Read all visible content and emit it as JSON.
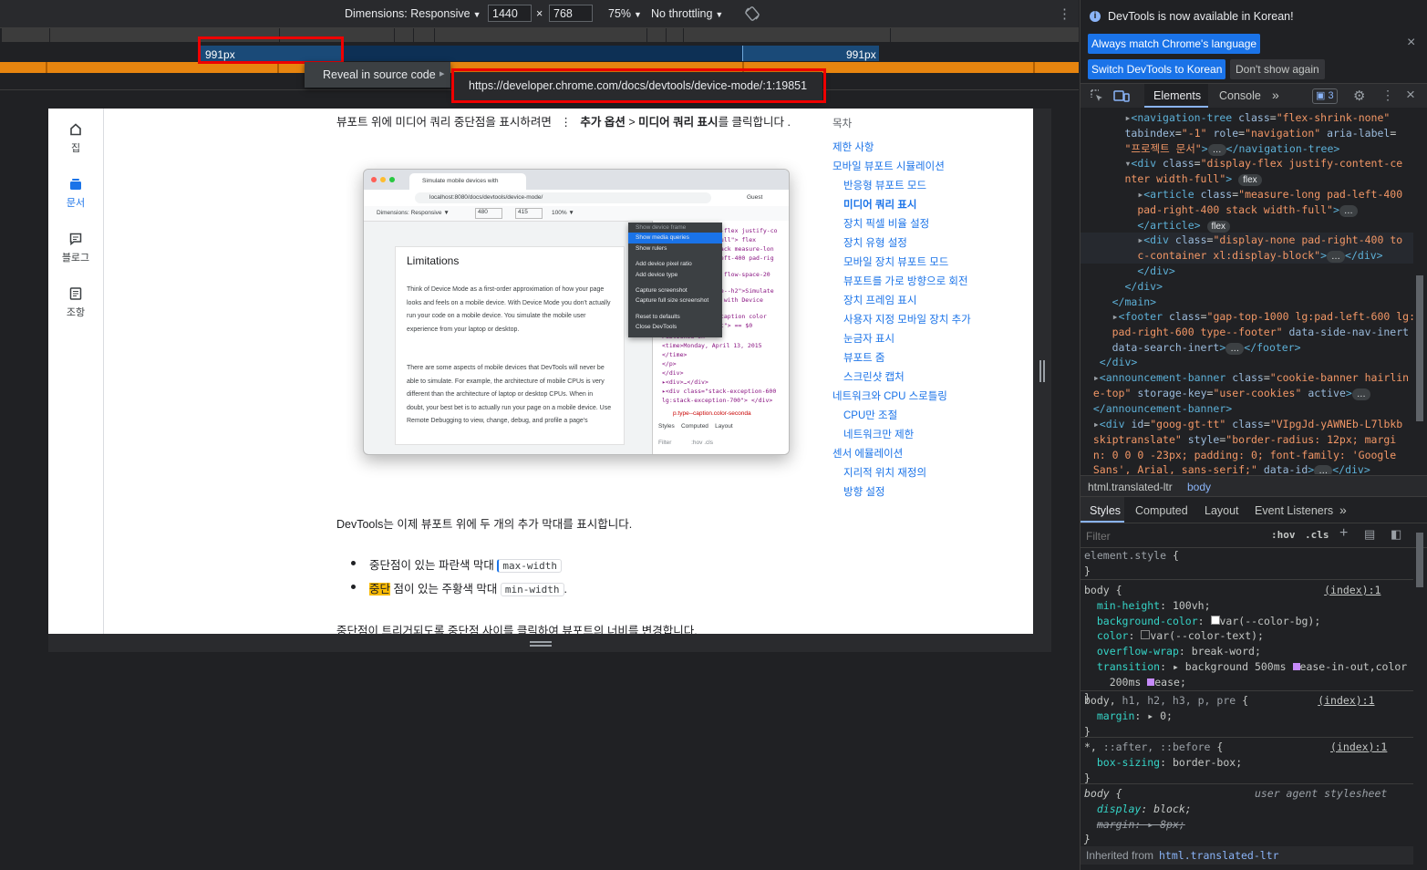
{
  "device_toolbar": {
    "dimensions_label": "Dimensions: Responsive",
    "width_value": "1440",
    "times": "×",
    "height_value": "768",
    "zoom": "75%",
    "throttling": "No throttling",
    "caret": "▼",
    "more": "⋮"
  },
  "media_queries": {
    "left_label": "991px",
    "right_label": "991px"
  },
  "context_menu": {
    "item": "Reveal in source code",
    "arrow": "▸",
    "url": "https://developer.chrome.com/docs/devtools/device-mode/:1:19851"
  },
  "page": {
    "nav": [
      {
        "label": "집",
        "icon": "home-icon"
      },
      {
        "label": "문서",
        "icon": "docs-icon"
      },
      {
        "label": "블로그",
        "icon": "blog-icon"
      },
      {
        "label": "조항",
        "icon": "article-icon"
      }
    ],
    "intro_text": "뷰포트 위에 미디어 쿼리 중단점을 표시하려면",
    "intro_dots": "⋮",
    "intro_more": "추가 옵션",
    "intro_gt": ">",
    "intro_show": "미디어 쿼리 표시",
    "intro_end": "를 클릭합니다 .",
    "para1": "DevTools는 이제 뷰포트 위에 두 개의 추가 막대를 표시합니다.",
    "bullet1_text": "중단점이 있는 파란색 막대",
    "bullet1_code": "max-width",
    "bullet2_hl": "중단",
    "bullet2_text": "점이 있는 주황색 막대",
    "bullet2_code": "min-width",
    "bullet2_end": ".",
    "para2": "중단점이 트리거되도록 중단점 사이를 클릭하여 뷰포트의 너비를 변경합니다.",
    "toc_title": "목차",
    "toc": [
      "제한 사항",
      "모바일 뷰포트 시뮬레이션",
      "반응형 뷰포트 모드",
      "미디어 쿼리 표시",
      "장치 픽셀 비율 설정",
      "장치 유형 설정",
      "모바일 장치 뷰포트 모드",
      "뷰포트를 가로 방향으로 회전",
      "장치 프레임 표시",
      "사용자 지정 모바일 장치 추가",
      "눈금자 표시",
      "뷰포트 줌",
      "스크린샷 캡처",
      "네트워크와 CPU 스로틀링",
      "CPU만 조절",
      "네트워크만 제한",
      "센서 에뮬레이션",
      "지리적 위치 재정의",
      "방향 설정"
    ],
    "screenshot": {
      "tab_title": "Simulate mobile devices with",
      "address": "localhost:8080/docs/devtools/device-mode/",
      "guest": "Guest",
      "dims": "Dimensions: Responsive ▼",
      "w": "480",
      "h": "415",
      "zoom": "100% ▼",
      "heading": "Limitations",
      "body1": "Think of Device Mode as a first-order approximation of how your page looks and feels on a mobile device. With Device Mode you don't actually run your code on a mobile device. You simulate the mobile user experience from your laptop or desktop.",
      "body2": "There are some aspects of mobile devices that DevTools will never be able to simulate. For example, the architecture of mobile CPUs is very different than the architecture of laptop or desktop CPUs. When in doubt, your best bet is to actually run your page on a mobile device. Use Remote Debugging to view, change, debug, and profile a page's",
      "menu": [
        "Show device frame",
        "Show media queries",
        "Show rulers",
        "Add device pixel ratio",
        "Add device type",
        "Capture screenshot",
        "Capture full size screenshot",
        "Reset to defaults",
        "Close DevTools"
      ],
      "dt_tabs": [
        "Styles",
        "Computed",
        "Layout"
      ],
      "filter": "Filter",
      "hov": ":hov",
      "cls": ".cls",
      "code_lines": [
        "--flex justify-co",
        "full\"> flex",
        "tack measure-lon",
        "left-400 pad-rig",
        "k flow-space-20",
        "pe--h2\">Simulate",
        "s with Device",
        "-caption color",
        "xt\"> == $0",
        "Published on \"",
        "<time>Monday, April 13, 2015",
        "</time>",
        "</p>",
        "</div>",
        "▸<div>…</div>",
        "▸<div class=\"stack-exception-600",
        "lg:stack-exception-700\"> </div>",
        "p.type--caption.color-seconda"
      ]
    }
  },
  "devtools": {
    "notice": "DevTools is now available in Korean!",
    "btn_match": "Always match Chrome's language",
    "btn_switch": "Switch DevTools to Korean",
    "btn_dont": "Don't show again",
    "tabs": {
      "elements": "Elements",
      "console": "Console",
      "more": "»",
      "issues": "3"
    },
    "crumbs": {
      "html": "html.translated-ltr",
      "body": "body"
    },
    "sub_tabs": {
      "styles": "Styles",
      "computed": "Computed",
      "layout": "Layout",
      "listeners": "Event Listeners",
      "more": "»"
    },
    "filter_placeholder": "Filter",
    "hov": ":hov",
    "cls": ".cls",
    "inherited_label": "Inherited from",
    "inherited_link": "html.translated-ltr"
  }
}
